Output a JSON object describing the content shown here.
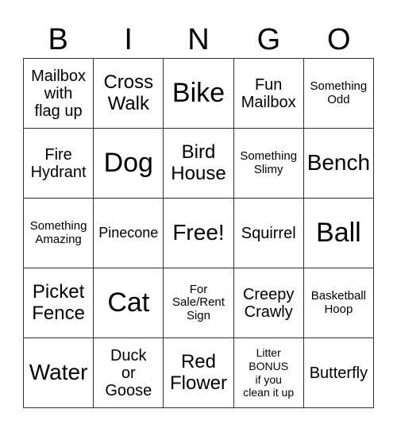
{
  "header": [
    "B",
    "I",
    "N",
    "G",
    "O"
  ],
  "cells": [
    {
      "text": "Mailbox\nwith\nflag up",
      "size": "s4"
    },
    {
      "text": "Cross\nWalk",
      "size": "s3"
    },
    {
      "text": "Bike",
      "size": "s1"
    },
    {
      "text": "Fun\nMailbox",
      "size": "s4"
    },
    {
      "text": "Something\nOdd",
      "size": "s6"
    },
    {
      "text": "Fire\nHydrant",
      "size": "s4"
    },
    {
      "text": "Dog",
      "size": "s1"
    },
    {
      "text": "Bird\nHouse",
      "size": "s3"
    },
    {
      "text": "Something\nSlimy",
      "size": "s6"
    },
    {
      "text": "Bench",
      "size": "s2"
    },
    {
      "text": "Something\nAmazing",
      "size": "s6"
    },
    {
      "text": "Pinecone",
      "size": "s5"
    },
    {
      "text": "Free!",
      "size": "s2"
    },
    {
      "text": "Squirrel",
      "size": "s4"
    },
    {
      "text": "Ball",
      "size": "s1"
    },
    {
      "text": "Picket\nFence",
      "size": "s3"
    },
    {
      "text": "Cat",
      "size": "s1"
    },
    {
      "text": "For\nSale/Rent\nSign",
      "size": "s6"
    },
    {
      "text": "Creepy\nCrawly",
      "size": "s4"
    },
    {
      "text": "Basketball\nHoop",
      "size": "s6"
    },
    {
      "text": "Water",
      "size": "s2"
    },
    {
      "text": "Duck\nor\nGoose",
      "size": "s4"
    },
    {
      "text": "Red\nFlower",
      "size": "s3"
    },
    {
      "text": "Litter\nBONUS\nif you\nclean it up",
      "size": "s7"
    },
    {
      "text": "Butterfly",
      "size": "s4"
    }
  ]
}
